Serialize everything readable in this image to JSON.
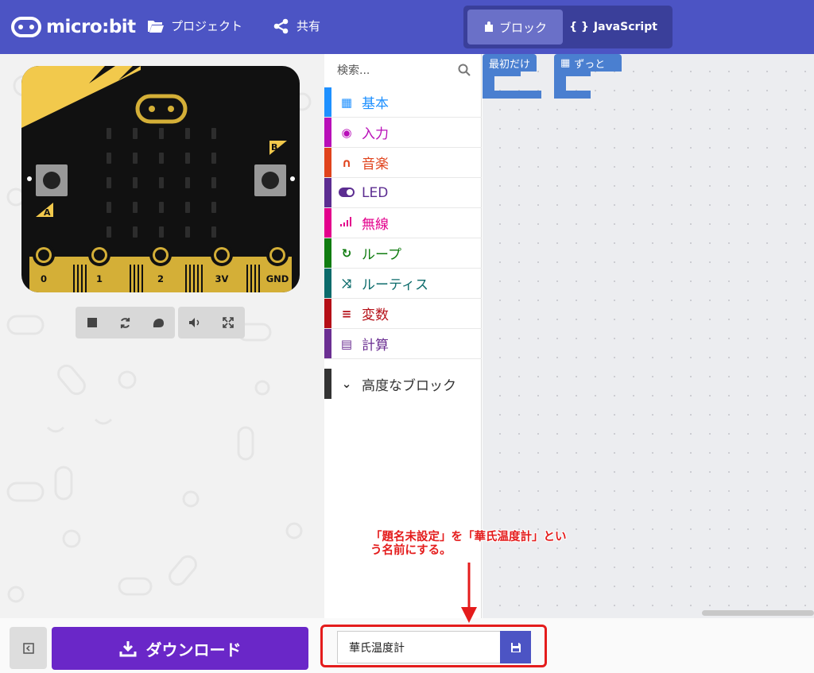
{
  "header": {
    "logo_text": "micro:bit",
    "projects_label": "プロジェクト",
    "share_label": "共有",
    "blocks_label": "ブロック",
    "javascript_label": "JavaScript",
    "brand_color": "#4c54c4"
  },
  "simulator": {
    "pins": [
      "0",
      "1",
      "2",
      "3V",
      "GND"
    ],
    "button_a": "A",
    "button_b": "B",
    "controls": [
      "stop-icon",
      "restart-icon",
      "slow-motion-icon",
      "mute-icon",
      "fullscreen-icon"
    ]
  },
  "toolbox": {
    "search_placeholder": "検索...",
    "categories": [
      {
        "label": "基本",
        "color": "#1e90ff",
        "icon": "grid-icon"
      },
      {
        "label": "入力",
        "color": "#b80fb8",
        "icon": "target-icon"
      },
      {
        "label": "音楽",
        "color": "#e0431c",
        "icon": "headphones-icon"
      },
      {
        "label": "LED",
        "color": "#5c2d91",
        "icon": "toggle-icon"
      },
      {
        "label": "無線",
        "color": "#e3008c",
        "icon": "signal-icon"
      },
      {
        "label": "ループ",
        "color": "#107c10",
        "icon": "loop-icon"
      },
      {
        "label": "ルーティス",
        "color": "#0c6b6b",
        "icon": "shuffle-icon"
      },
      {
        "label": "変数",
        "color": "#b50f17",
        "icon": "list-icon"
      },
      {
        "label": "計算",
        "color": "#6b2f92",
        "icon": "calculator-icon"
      }
    ],
    "advanced_label": "高度なブロック"
  },
  "workspace": {
    "block_on_start": "最初だけ",
    "block_forever": "ずっと"
  },
  "footer": {
    "download_label": "ダウンロード",
    "project_name": "華氏温度計"
  },
  "annotation": {
    "text": "「題名未設定」を「華氏温度計」とい\nう名前にする。",
    "color": "#e41c1c"
  }
}
